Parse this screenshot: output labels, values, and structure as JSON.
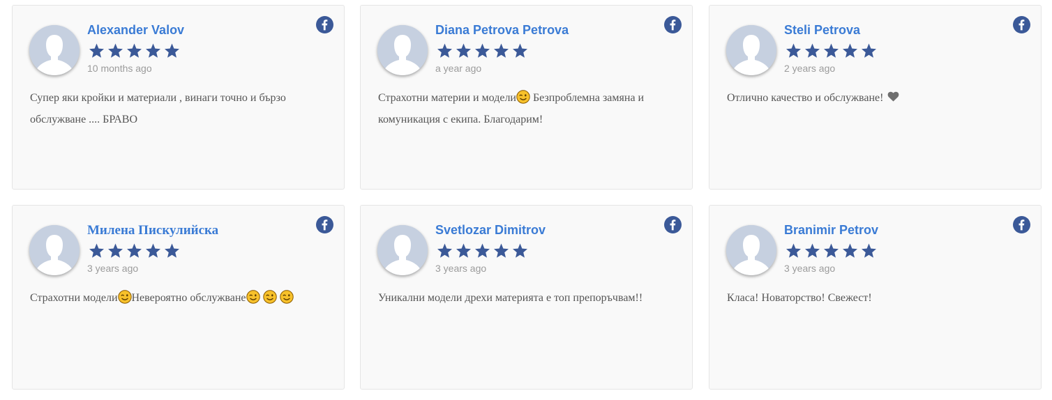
{
  "colors": {
    "name": "#3a7bd5",
    "star": "#3b5998",
    "facebook": "#3b5998",
    "card_bg": "#f9f9f9",
    "time": "#9b9b9b",
    "text": "#555555"
  },
  "reviews": [
    {
      "name": "Alexander Valov",
      "rating": 5,
      "time": "10 months ago",
      "text": "Супер яки кройки и материали , винаги точно и бързо обслужване .... БРАВО",
      "source_icon": "facebook-icon"
    },
    {
      "name": "Diana Petrova Petrova",
      "rating": 5,
      "time": "a year ago",
      "text_before": "Страхотни материи и модели",
      "text_after": " Безпроблемна замяна и комуникация с екипа. Благодарим!",
      "emoji": "wink-emoji-icon",
      "source_icon": "facebook-icon"
    },
    {
      "name": "Steli Petrova",
      "rating": 5,
      "time": "2 years ago",
      "text": "Отлично качество и обслужване!",
      "emoji": "heart-icon",
      "source_icon": "facebook-icon"
    },
    {
      "name": "Милена Пискулийска",
      "rating": 5,
      "time": "3 years ago",
      "text_before": "Страхотни модели",
      "text_after": "Невероятно обслужване",
      "emoji": "wink-emoji-icon",
      "source_icon": "facebook-icon"
    },
    {
      "name": "Svetlozar Dimitrov",
      "rating": 5,
      "time": "3 years ago",
      "text": "Уникални модели дрехи материята е топ препоръчвам!!",
      "source_icon": "facebook-icon"
    },
    {
      "name": "Branimir Petrov",
      "rating": 5,
      "time": "3 years ago",
      "text": "Класа! Новаторство! Свежест!",
      "source_icon": "facebook-icon"
    }
  ]
}
